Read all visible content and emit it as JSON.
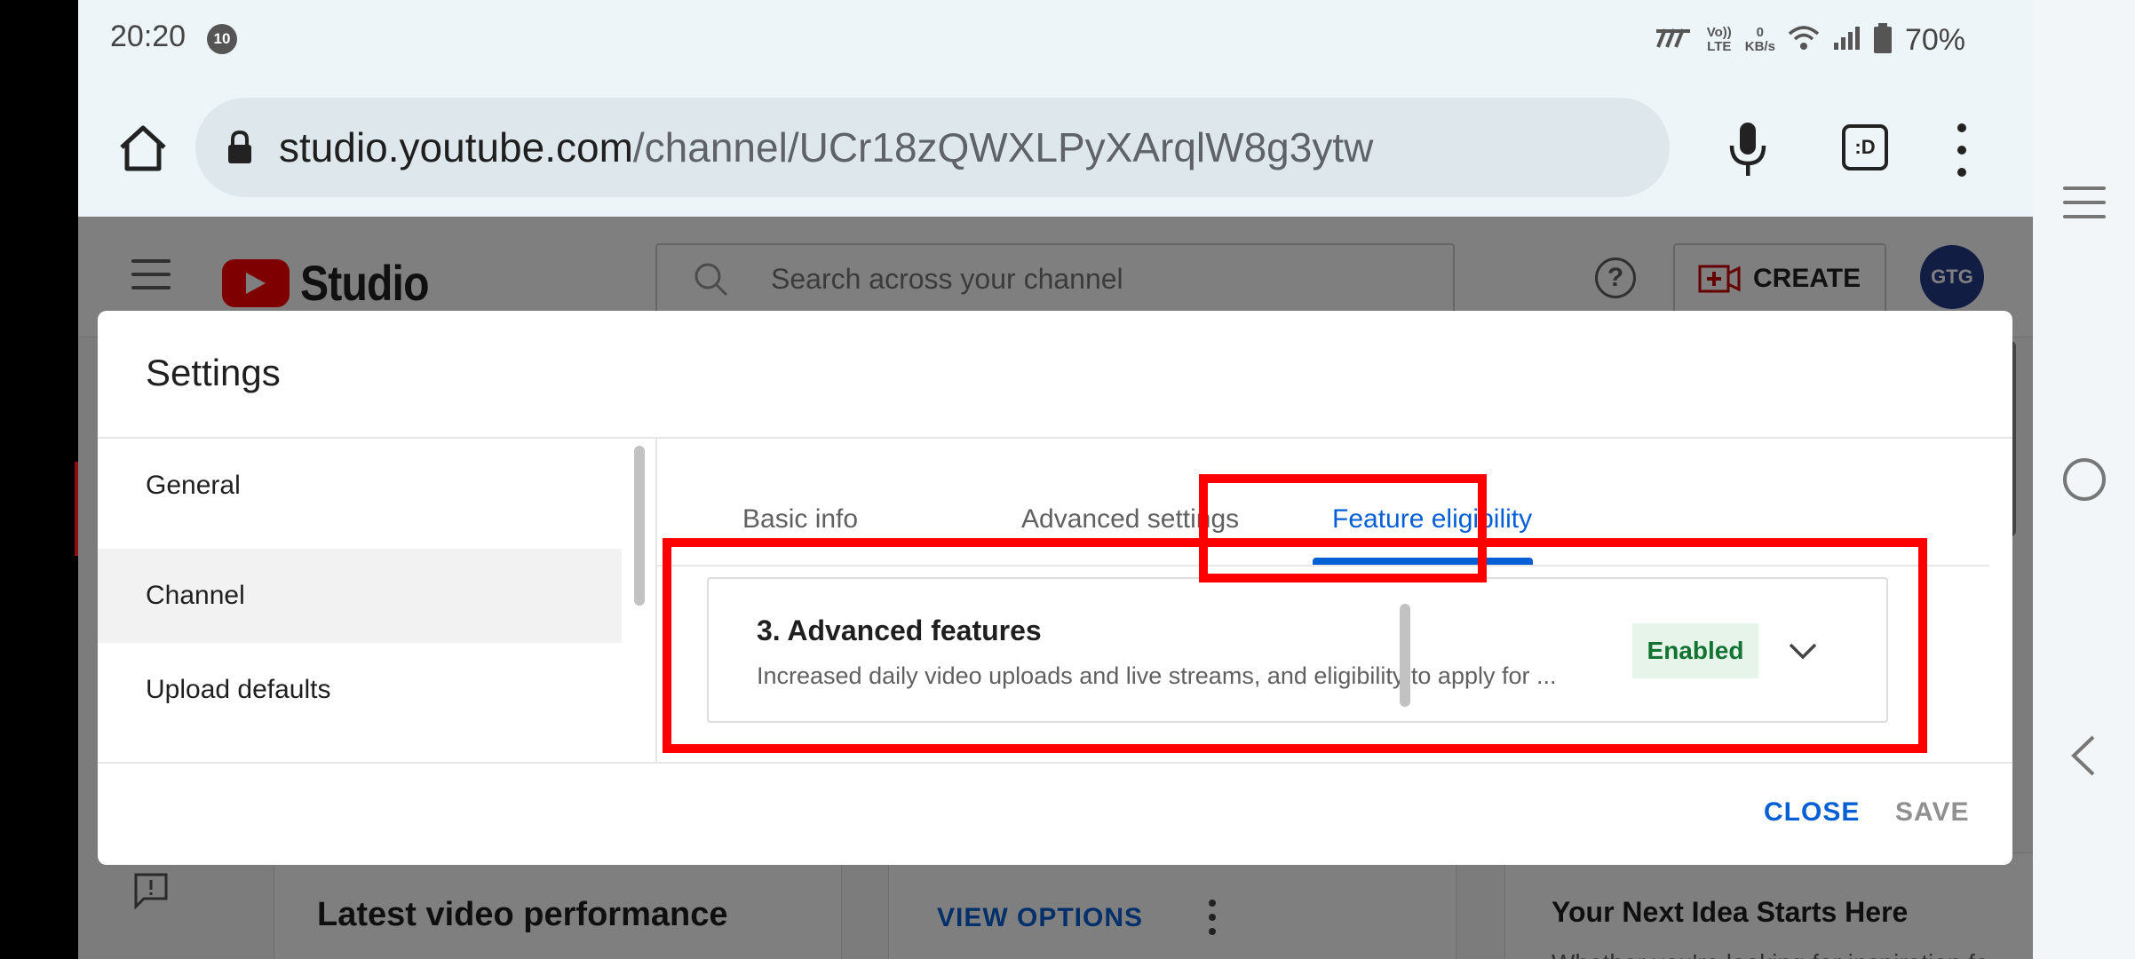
{
  "status_bar": {
    "time": "20:20",
    "notification_badge": "10",
    "network_label": "Vo)) LTE",
    "data_speed_value": "0",
    "data_speed_unit": "KB/s",
    "battery": "70%"
  },
  "browser": {
    "url_domain": "studio.youtube.com",
    "url_path": "/channel/UCr18zQWXLPyXArqlW8g3ytw",
    "tabs_icon_text": ":D"
  },
  "studio": {
    "logo_text": "Studio",
    "search_placeholder": "Search across your channel",
    "create_label": "CREATE",
    "avatar_text": "GTG",
    "cards": {
      "latest_video_title": "Latest video performance",
      "view_options": "VIEW OPTIONS",
      "idea_title": "Your Next Idea Starts Here",
      "idea_subtitle": "Whether you're looking for inspiration fo"
    }
  },
  "dialog": {
    "title": "Settings",
    "nav_items": [
      {
        "label": "General"
      },
      {
        "label": "Channel"
      },
      {
        "label": "Upload defaults"
      }
    ],
    "active_nav": "Channel",
    "tabs": [
      {
        "label": "Basic info"
      },
      {
        "label": "Advanced settings"
      },
      {
        "label": "Feature eligibility"
      }
    ],
    "active_tab": "Feature eligibility",
    "feature": {
      "title": "3. Advanced features",
      "description": "Increased daily video uploads and live streams, and eligibility to apply for ...",
      "status": "Enabled"
    },
    "close_label": "CLOSE",
    "save_label": "SAVE"
  },
  "colors": {
    "accent_blue": "#065fd4",
    "annotation_red": "#ff0000",
    "enabled_green": "#137333",
    "youtube_red": "#ff0000"
  }
}
